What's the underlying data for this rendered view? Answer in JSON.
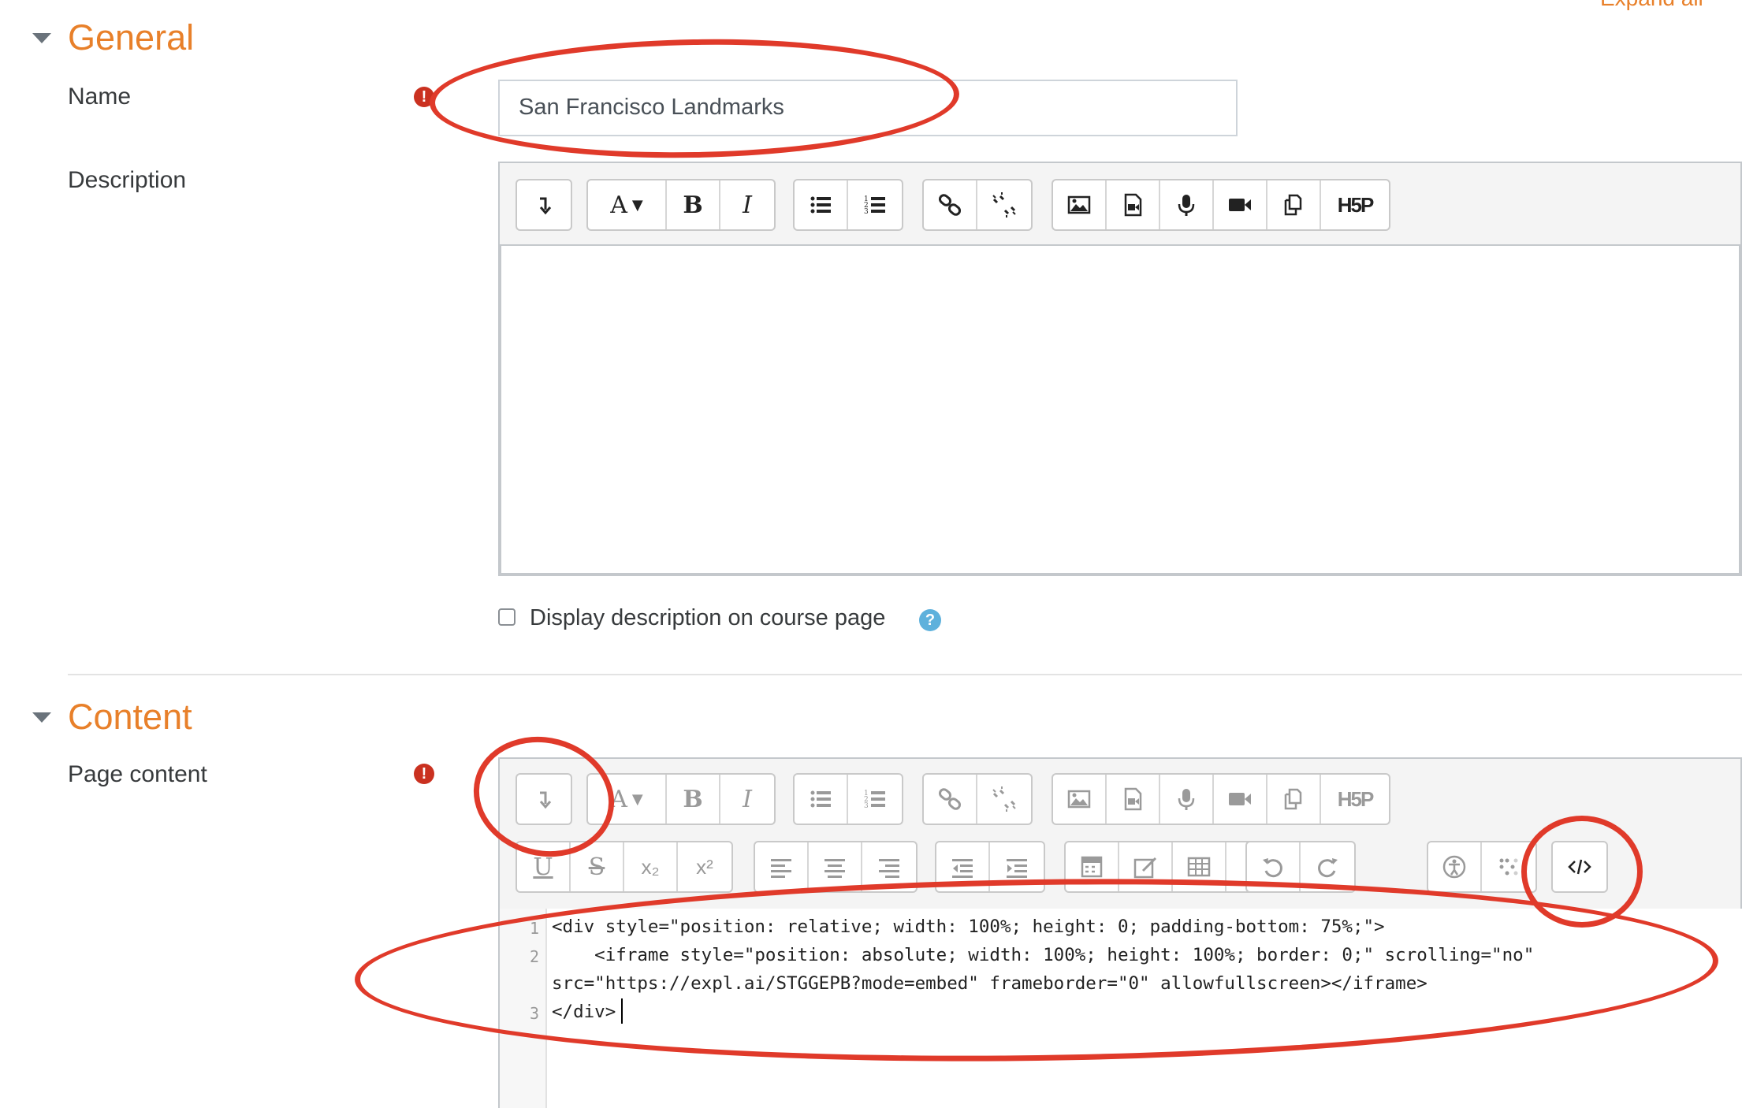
{
  "header": {
    "expand_all": "Expand all"
  },
  "general": {
    "title": "General",
    "name_label": "Name",
    "name_value": "San Francisco Landmarks",
    "description_label": "Description",
    "display_description_label": "Display description on course page",
    "help_glyph": "?"
  },
  "content": {
    "title": "Content",
    "page_content_label": "Page content"
  },
  "editor_buttons": {
    "toolbar_toggle": "toolbar-toggle-icon",
    "font_style": "A",
    "bold": "B",
    "italic": "I",
    "row1_icons": [
      "unordered-list-icon",
      "ordered-list-icon",
      "link-icon",
      "unlink-icon",
      "image-icon",
      "media-icon",
      "record-audio-icon",
      "record-video-icon",
      "manage-files-icon",
      "h5p-icon"
    ],
    "h5p_label": "H5P",
    "subscript": "x₂",
    "superscript": "x²",
    "row2_icons": [
      "underline-icon",
      "strikethrough-icon",
      "align-left-icon",
      "align-center-icon",
      "align-right-icon",
      "outdent-icon",
      "indent-icon",
      "equation-icon",
      "special-char-icon",
      "table-icon",
      "clear-formatting-icon",
      "undo-icon",
      "redo-icon",
      "accessibility-checker-icon",
      "screenreader-helper-icon",
      "html-source-icon"
    ]
  },
  "code": {
    "line_numbers": [
      "1",
      "2",
      "3"
    ],
    "line1": "<div style=\"position: relative; width: 100%; height: 0; padding-bottom: 75%;\">",
    "line2a": "    <iframe style=\"position: absolute; width: 100%; height: 100%; border: 0;\" scrolling=\"no\"",
    "line2b": "src=\"https://expl.ai/STGGEPB?mode=embed\" frameborder=\"0\" allowfullscreen></iframe>",
    "line3": "</div>"
  },
  "annotation_color": "#e03a2a",
  "accent_color": "#e8802a"
}
